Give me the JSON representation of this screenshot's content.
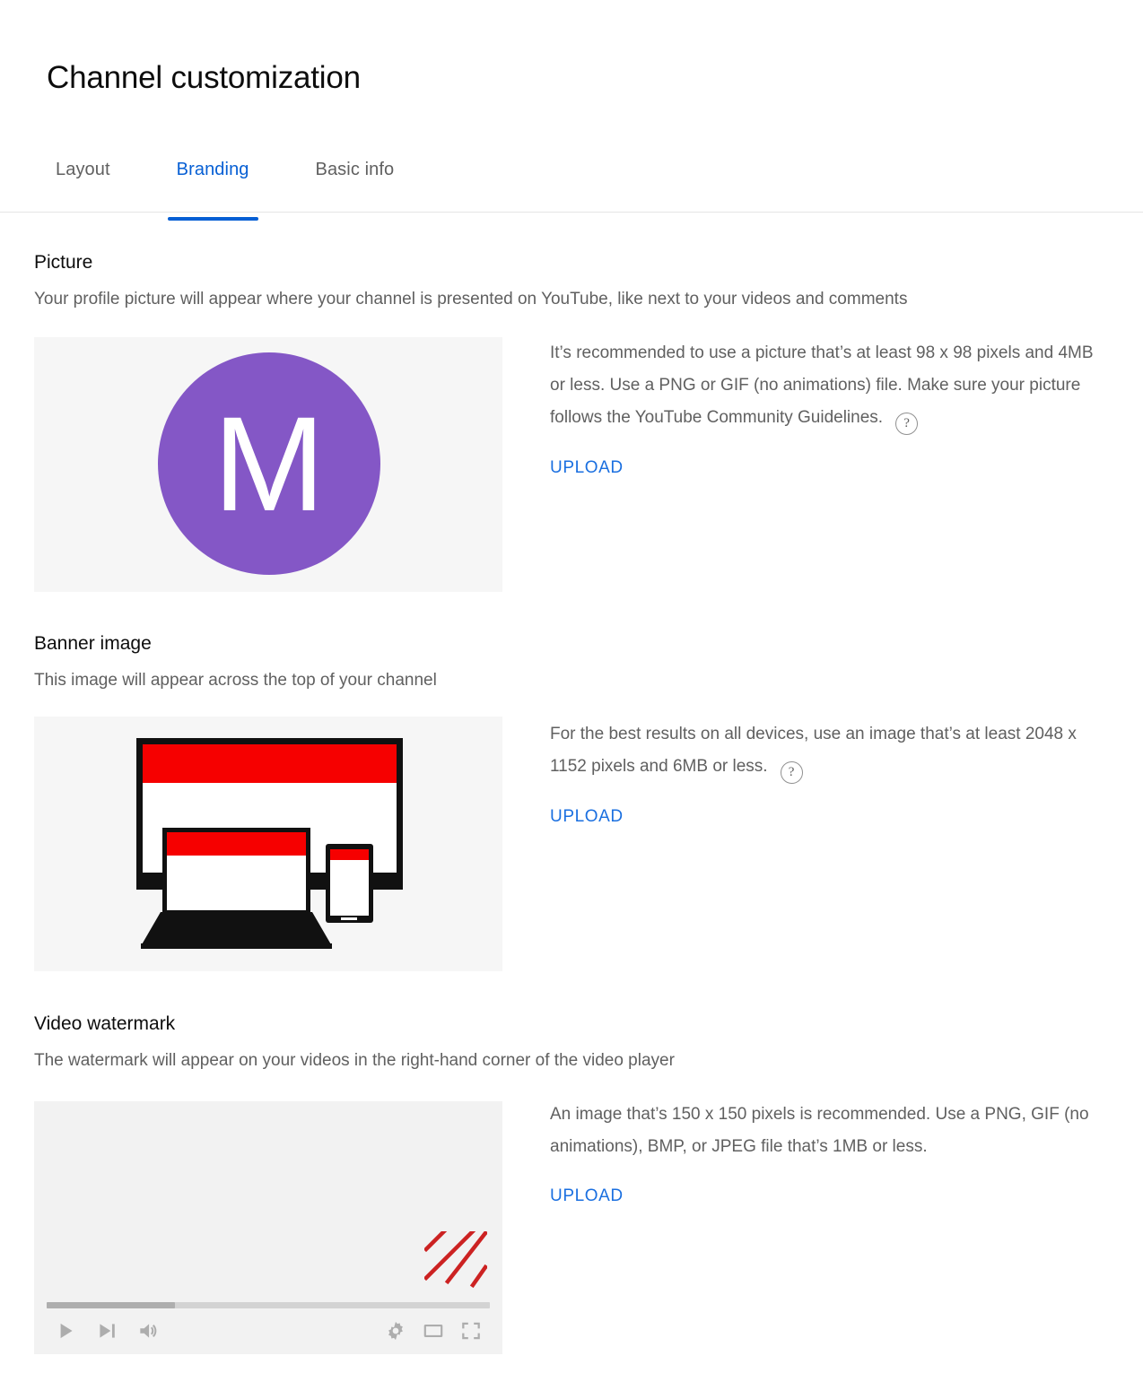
{
  "page": {
    "title": "Channel customization"
  },
  "tabs": [
    {
      "label": "Layout",
      "active": false
    },
    {
      "label": "Branding",
      "active": true
    },
    {
      "label": "Basic info",
      "active": false
    }
  ],
  "sections": {
    "picture": {
      "title": "Picture",
      "description": "Your profile picture will appear where your channel is presented on YouTube, like next to your videos and comments",
      "guidance": "It’s recommended to use a picture that’s at least 98 x 98 pixels and 4MB or less. Use a PNG or GIF (no animations) file. Make sure your picture follows the YouTube Community Guidelines.",
      "help_icon": "?",
      "upload_label": "UPLOAD",
      "avatar": {
        "initial": "M",
        "background_color": "#8457c6",
        "text_color": "#ffffff"
      }
    },
    "banner": {
      "title": "Banner image",
      "description": "This image will appear across the top of your channel",
      "guidance": "For the best results on all devices, use an image that’s at least 2048 x 1152 pixels and 6MB or less.",
      "help_icon": "?",
      "upload_label": "UPLOAD",
      "illustration": {
        "devices": [
          "monitor",
          "laptop",
          "phone"
        ],
        "banner_stripe_color": "#f60000",
        "device_frame_color": "#111111",
        "screen_color": "#ffffff"
      }
    },
    "watermark": {
      "title": "Video watermark",
      "description": "The watermark will appear on your videos in the right-hand corner of the video player",
      "guidance": "An image that’s 150 x 150 pixels is recommended. Use a PNG, GIF (no animations), BMP, or JPEG file that’s 1MB or less.",
      "upload_label": "UPLOAD",
      "player": {
        "progress_percent": 29,
        "hatch_color": "#cc2222",
        "controls_left": [
          "play-icon",
          "next-icon",
          "volume-icon"
        ],
        "controls_right": [
          "settings-gear-icon",
          "miniplayer-icon",
          "fullscreen-icon"
        ]
      }
    }
  },
  "colors": {
    "accent_blue": "#065fd4",
    "link_blue": "#1a6fe0",
    "text_primary": "#0d0d0d",
    "text_secondary": "#606060",
    "preview_background": "#f6f6f6",
    "youtube_red": "#f60000"
  }
}
